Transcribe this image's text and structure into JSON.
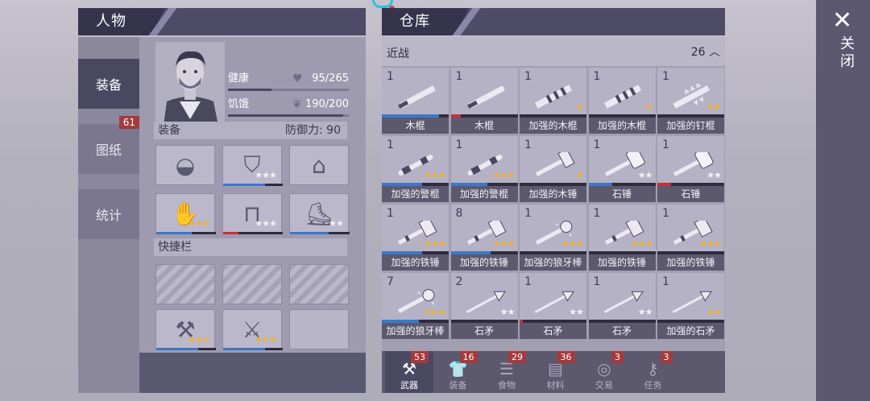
{
  "character": {
    "title": "人物",
    "tabs": [
      {
        "label": "装备",
        "badge": ""
      },
      {
        "label": "图纸",
        "badge": "61"
      },
      {
        "label": "统计",
        "badge": ""
      }
    ],
    "health": {
      "label": "健康",
      "value": "95/265",
      "fraction": 0.36
    },
    "hunger": {
      "label": "饥饿",
      "value": "190/200",
      "fraction": 0.95
    },
    "equip_label": "装备",
    "defense": "防御力: 90",
    "quickbar_label": "快捷栏",
    "equip_slots": [
      {
        "icon": "helmet-icon",
        "stars": "",
        "durability": 0
      },
      {
        "icon": "vest-icon",
        "stars": "★★★",
        "star_color": "white",
        "durability": 0.7
      },
      {
        "icon": "jacket-icon",
        "stars": "",
        "durability": 0
      },
      {
        "icon": "gloves-icon",
        "stars": "★★★",
        "star_color": "gold",
        "durability": 0.6
      },
      {
        "icon": "pants-icon",
        "stars": "★★★",
        "star_color": "white",
        "durability": 0.25
      },
      {
        "icon": "boots-icon",
        "stars": "★★",
        "star_color": "white",
        "durability": 0.65
      }
    ],
    "quick_slots": [
      {
        "icon": "locked-slot-icon",
        "stars": ""
      },
      {
        "icon": "locked-slot-icon",
        "stars": ""
      },
      {
        "icon": "locked-slot-icon",
        "stars": ""
      },
      {
        "icon": "axe-icon",
        "stars": "★★★",
        "star_color": "gold",
        "durability": 0.7
      },
      {
        "icon": "spiked-club-icon",
        "stars": "★★★",
        "star_color": "gold",
        "durability": 0.7
      },
      {
        "icon": "empty-slot",
        "stars": ""
      }
    ]
  },
  "storage": {
    "title": "仓库",
    "category": "近战",
    "count": "26",
    "items": [
      {
        "count": "1",
        "name": "木棍",
        "stars": "",
        "star_color": "gold",
        "durability": 0.85,
        "dur_color": "#3d77c6",
        "icon": "stick-icon"
      },
      {
        "count": "1",
        "name": "木棍",
        "stars": "",
        "star_color": "gold",
        "durability": 0.15,
        "dur_color": "#c0343a",
        "icon": "stick-icon"
      },
      {
        "count": "1",
        "name": "加强的木棍",
        "stars": "★",
        "star_color": "gold",
        "durability": 0.0,
        "dur_color": "#3d77c6",
        "icon": "reinforced-stick-icon"
      },
      {
        "count": "1",
        "name": "加强的木棍",
        "stars": "★",
        "star_color": "gold",
        "durability": 0.0,
        "dur_color": "#3d77c6",
        "icon": "reinforced-stick-icon"
      },
      {
        "count": "1",
        "name": "加强的钉棍",
        "stars": "★★",
        "star_color": "gold",
        "durability": 0.0,
        "dur_color": "#3d77c6",
        "icon": "spiked-club-icon"
      },
      {
        "count": "1",
        "name": "加强的警棍",
        "stars": "★★★",
        "star_color": "gold",
        "durability": 0.6,
        "dur_color": "#3d77c6",
        "icon": "baton-icon"
      },
      {
        "count": "1",
        "name": "加强的警棍",
        "stars": "★★★",
        "star_color": "gold",
        "durability": 0.55,
        "dur_color": "#3d77c6",
        "icon": "baton-icon"
      },
      {
        "count": "1",
        "name": "加强的木锤",
        "stars": "★",
        "star_color": "gold",
        "durability": 0.0,
        "dur_color": "#3d77c6",
        "icon": "mallet-icon"
      },
      {
        "count": "1",
        "name": "石锤",
        "stars": "★★",
        "star_color": "white",
        "durability": 0.35,
        "dur_color": "#3d77c6",
        "icon": "stone-hammer-icon"
      },
      {
        "count": "1",
        "name": "石锤",
        "stars": "★★",
        "star_color": "white",
        "durability": 0.2,
        "dur_color": "#c0343a",
        "icon": "stone-hammer-icon"
      },
      {
        "count": "1",
        "name": "加强的铁锤",
        "stars": "★★★",
        "star_color": "gold",
        "durability": 0.6,
        "dur_color": "#3d77c6",
        "icon": "iron-hammer-icon"
      },
      {
        "count": "8",
        "name": "加强的铁锤",
        "stars": "★★★",
        "star_color": "gold",
        "durability": 0.6,
        "dur_color": "#3d77c6",
        "icon": "iron-hammer-icon"
      },
      {
        "count": "1",
        "name": "加强的狼牙棒",
        "stars": "★★★",
        "star_color": "gold",
        "durability": 0.0,
        "dur_color": "#3d77c6",
        "icon": "mace-icon"
      },
      {
        "count": "1",
        "name": "加强的铁锤",
        "stars": "★★★",
        "star_color": "gold",
        "durability": 0.0,
        "dur_color": "#3d77c6",
        "icon": "iron-hammer-icon"
      },
      {
        "count": "1",
        "name": "加强的铁锤",
        "stars": "★★★",
        "star_color": "gold",
        "durability": 0.0,
        "dur_color": "#3d77c6",
        "icon": "iron-hammer-icon"
      },
      {
        "count": "7",
        "name": "加强的狼牙棒",
        "stars": "★★★",
        "star_color": "gold",
        "durability": 0.55,
        "dur_color": "#3d77c6",
        "icon": "mace-icon"
      },
      {
        "count": "2",
        "name": "石矛",
        "stars": "★★",
        "star_color": "white",
        "durability": 0.0,
        "dur_color": "#3d77c6",
        "icon": "spear-icon"
      },
      {
        "count": "1",
        "name": "石矛",
        "stars": "★★",
        "star_color": "white",
        "durability": 0.05,
        "dur_color": "#c0343a",
        "icon": "spear-icon"
      },
      {
        "count": "1",
        "name": "石矛",
        "stars": "★★",
        "star_color": "white",
        "durability": 0.0,
        "dur_color": "#3d77c6",
        "icon": "spear-icon"
      },
      {
        "count": "1",
        "name": "加强的石矛",
        "stars": "★★",
        "star_color": "gold",
        "durability": 0.0,
        "dur_color": "#3d77c6",
        "icon": "spear-icon"
      }
    ],
    "bottom_tabs": [
      {
        "label": "武器",
        "badge": "53",
        "icon": "axe-icon",
        "active": true
      },
      {
        "label": "装备",
        "badge": "16",
        "icon": "shirt-icon",
        "active": false
      },
      {
        "label": "食物",
        "badge": "29",
        "icon": "food-icon",
        "active": false
      },
      {
        "label": "材料",
        "badge": "36",
        "icon": "material-icon",
        "active": false
      },
      {
        "label": "交易",
        "badge": "3",
        "icon": "coin-icon",
        "active": false
      },
      {
        "label": "任务",
        "badge": "3",
        "icon": "key-icon",
        "active": false
      }
    ]
  },
  "close": {
    "label": "关闭"
  }
}
